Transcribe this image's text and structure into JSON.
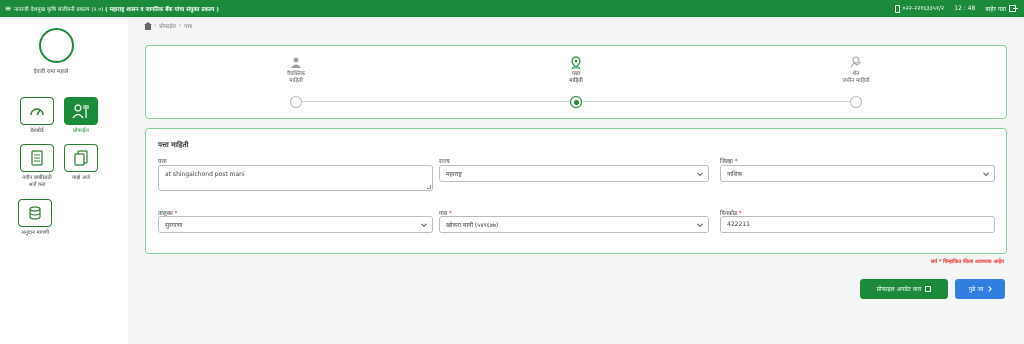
{
  "topbar": {
    "title_main": "नानाजी देशमुख कृषि संजीवनी प्रकल्प (२.०)",
    "title_sub": "( महाराष्ट्र शासन व जागतिक बँक यांचा संयुक्त प्रकल्प )",
    "phone": "०२२-२२१६३३५१/२",
    "time": "12 : 48",
    "logout": "बाहेर पडा"
  },
  "sidebar": {
    "user_name": "देवजी रामा महाले",
    "items": [
      {
        "label": "डॅशबोर्ड",
        "icon": "dashboard-gauge-icon"
      },
      {
        "label": "प्रोफाईल",
        "icon": "farmer-profile-icon"
      },
      {
        "label": "नवीन बाबींसाठी अर्ज करा",
        "icon": "new-application-checklist-icon"
      },
      {
        "label": "माझे अर्ज",
        "icon": "my-applications-icon"
      },
      {
        "label": "अनुदान मागणी",
        "icon": "subsidy-coins-icon"
      }
    ]
  },
  "breadcrumb": {
    "items": [
      "प्रोफाईल",
      "पत्ता"
    ]
  },
  "stepper": {
    "steps": [
      {
        "label_line1": "वैयक्तिक",
        "label_line2": "माहिती",
        "icon": "person-icon"
      },
      {
        "label_line1": "पत्ता",
        "label_line2": "माहिती",
        "icon": "location-pin-icon"
      },
      {
        "label_line1": "शेत",
        "label_line2": "जमीन माहिती",
        "icon": "land-icon"
      }
    ]
  },
  "form": {
    "title": "पत्ता माहिती",
    "address": {
      "label": "पत्ता",
      "value": "at shingalchond post mani"
    },
    "state": {
      "label": "राज्य",
      "value": "महाराष्ट्र"
    },
    "district": {
      "label": "जिल्हा",
      "value": "नाशिक"
    },
    "taluka": {
      "label": "तालुका",
      "value": "सुरगाणा"
    },
    "village": {
      "label": "गाव",
      "value": "खोकरा मानी (५४९६७७)"
    },
    "pincode": {
      "label": "पिनकोड",
      "value": "422211"
    },
    "required_mark": "*"
  },
  "note": "सर्व * चिन्हांकित फील्ड आवश्यक आहेत",
  "buttons": {
    "update": "प्रोफाइल अपडेट करा",
    "next": "पुढे जा"
  },
  "colors": {
    "primary": "#1b8a3a",
    "accent_blue": "#2f7ee0",
    "required": "#e53935"
  }
}
